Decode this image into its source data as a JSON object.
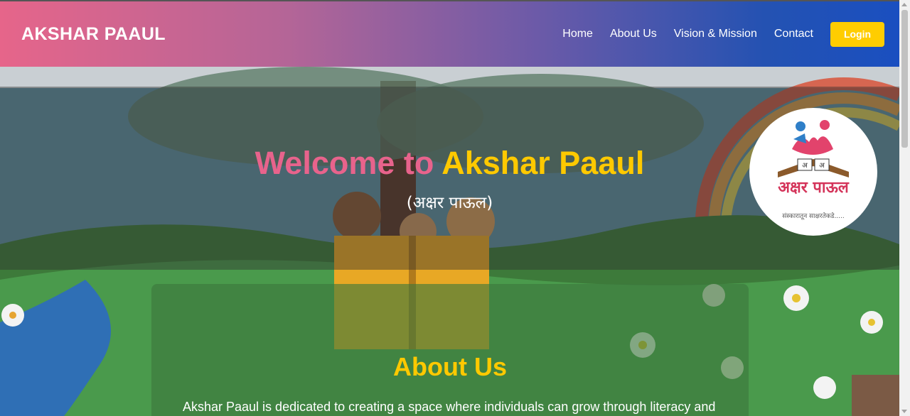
{
  "header": {
    "brand": "AKSHAR PAAUL",
    "nav": [
      {
        "label": "Home"
      },
      {
        "label": "About Us"
      },
      {
        "label": "Vision & Mission"
      },
      {
        "label": "Contact"
      }
    ],
    "login_label": "Login"
  },
  "hero": {
    "welcome_prefix": "Welcome to",
    "welcome_name": "Akshar Paaul",
    "subtitle": "(अक्षर पाऊल)"
  },
  "logo": {
    "name": "अक्षर पाऊल",
    "tagline": "संस्कारातून साक्षरतेकडे....."
  },
  "about": {
    "heading": "About Us",
    "text": "Akshar Paaul is dedicated to creating a space where individuals can grow through literacy and"
  },
  "colors": {
    "accent_pink": "#e8638c",
    "accent_yellow": "#ffc900",
    "nav_blue": "#1a4fc0",
    "login_button": "#ffcd00"
  }
}
